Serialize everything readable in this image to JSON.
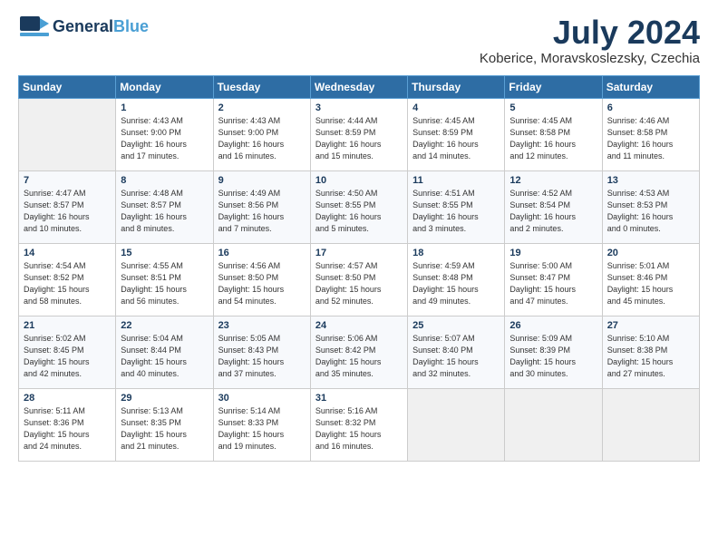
{
  "logo": {
    "general": "General",
    "blue": "Blue",
    "icon": "▶"
  },
  "title": {
    "month": "July 2024",
    "location": "Koberice, Moravskoslezsky, Czechia"
  },
  "weekdays": [
    "Sunday",
    "Monday",
    "Tuesday",
    "Wednesday",
    "Thursday",
    "Friday",
    "Saturday"
  ],
  "weeks": [
    [
      {
        "day": "",
        "info": ""
      },
      {
        "day": "1",
        "info": "Sunrise: 4:43 AM\nSunset: 9:00 PM\nDaylight: 16 hours\nand 17 minutes."
      },
      {
        "day": "2",
        "info": "Sunrise: 4:43 AM\nSunset: 9:00 PM\nDaylight: 16 hours\nand 16 minutes."
      },
      {
        "day": "3",
        "info": "Sunrise: 4:44 AM\nSunset: 8:59 PM\nDaylight: 16 hours\nand 15 minutes."
      },
      {
        "day": "4",
        "info": "Sunrise: 4:45 AM\nSunset: 8:59 PM\nDaylight: 16 hours\nand 14 minutes."
      },
      {
        "day": "5",
        "info": "Sunrise: 4:45 AM\nSunset: 8:58 PM\nDaylight: 16 hours\nand 12 minutes."
      },
      {
        "day": "6",
        "info": "Sunrise: 4:46 AM\nSunset: 8:58 PM\nDaylight: 16 hours\nand 11 minutes."
      }
    ],
    [
      {
        "day": "7",
        "info": "Sunrise: 4:47 AM\nSunset: 8:57 PM\nDaylight: 16 hours\nand 10 minutes."
      },
      {
        "day": "8",
        "info": "Sunrise: 4:48 AM\nSunset: 8:57 PM\nDaylight: 16 hours\nand 8 minutes."
      },
      {
        "day": "9",
        "info": "Sunrise: 4:49 AM\nSunset: 8:56 PM\nDaylight: 16 hours\nand 7 minutes."
      },
      {
        "day": "10",
        "info": "Sunrise: 4:50 AM\nSunset: 8:55 PM\nDaylight: 16 hours\nand 5 minutes."
      },
      {
        "day": "11",
        "info": "Sunrise: 4:51 AM\nSunset: 8:55 PM\nDaylight: 16 hours\nand 3 minutes."
      },
      {
        "day": "12",
        "info": "Sunrise: 4:52 AM\nSunset: 8:54 PM\nDaylight: 16 hours\nand 2 minutes."
      },
      {
        "day": "13",
        "info": "Sunrise: 4:53 AM\nSunset: 8:53 PM\nDaylight: 16 hours\nand 0 minutes."
      }
    ],
    [
      {
        "day": "14",
        "info": "Sunrise: 4:54 AM\nSunset: 8:52 PM\nDaylight: 15 hours\nand 58 minutes."
      },
      {
        "day": "15",
        "info": "Sunrise: 4:55 AM\nSunset: 8:51 PM\nDaylight: 15 hours\nand 56 minutes."
      },
      {
        "day": "16",
        "info": "Sunrise: 4:56 AM\nSunset: 8:50 PM\nDaylight: 15 hours\nand 54 minutes."
      },
      {
        "day": "17",
        "info": "Sunrise: 4:57 AM\nSunset: 8:50 PM\nDaylight: 15 hours\nand 52 minutes."
      },
      {
        "day": "18",
        "info": "Sunrise: 4:59 AM\nSunset: 8:48 PM\nDaylight: 15 hours\nand 49 minutes."
      },
      {
        "day": "19",
        "info": "Sunrise: 5:00 AM\nSunset: 8:47 PM\nDaylight: 15 hours\nand 47 minutes."
      },
      {
        "day": "20",
        "info": "Sunrise: 5:01 AM\nSunset: 8:46 PM\nDaylight: 15 hours\nand 45 minutes."
      }
    ],
    [
      {
        "day": "21",
        "info": "Sunrise: 5:02 AM\nSunset: 8:45 PM\nDaylight: 15 hours\nand 42 minutes."
      },
      {
        "day": "22",
        "info": "Sunrise: 5:04 AM\nSunset: 8:44 PM\nDaylight: 15 hours\nand 40 minutes."
      },
      {
        "day": "23",
        "info": "Sunrise: 5:05 AM\nSunset: 8:43 PM\nDaylight: 15 hours\nand 37 minutes."
      },
      {
        "day": "24",
        "info": "Sunrise: 5:06 AM\nSunset: 8:42 PM\nDaylight: 15 hours\nand 35 minutes."
      },
      {
        "day": "25",
        "info": "Sunrise: 5:07 AM\nSunset: 8:40 PM\nDaylight: 15 hours\nand 32 minutes."
      },
      {
        "day": "26",
        "info": "Sunrise: 5:09 AM\nSunset: 8:39 PM\nDaylight: 15 hours\nand 30 minutes."
      },
      {
        "day": "27",
        "info": "Sunrise: 5:10 AM\nSunset: 8:38 PM\nDaylight: 15 hours\nand 27 minutes."
      }
    ],
    [
      {
        "day": "28",
        "info": "Sunrise: 5:11 AM\nSunset: 8:36 PM\nDaylight: 15 hours\nand 24 minutes."
      },
      {
        "day": "29",
        "info": "Sunrise: 5:13 AM\nSunset: 8:35 PM\nDaylight: 15 hours\nand 21 minutes."
      },
      {
        "day": "30",
        "info": "Sunrise: 5:14 AM\nSunset: 8:33 PM\nDaylight: 15 hours\nand 19 minutes."
      },
      {
        "day": "31",
        "info": "Sunrise: 5:16 AM\nSunset: 8:32 PM\nDaylight: 15 hours\nand 16 minutes."
      },
      {
        "day": "",
        "info": ""
      },
      {
        "day": "",
        "info": ""
      },
      {
        "day": "",
        "info": ""
      }
    ]
  ]
}
